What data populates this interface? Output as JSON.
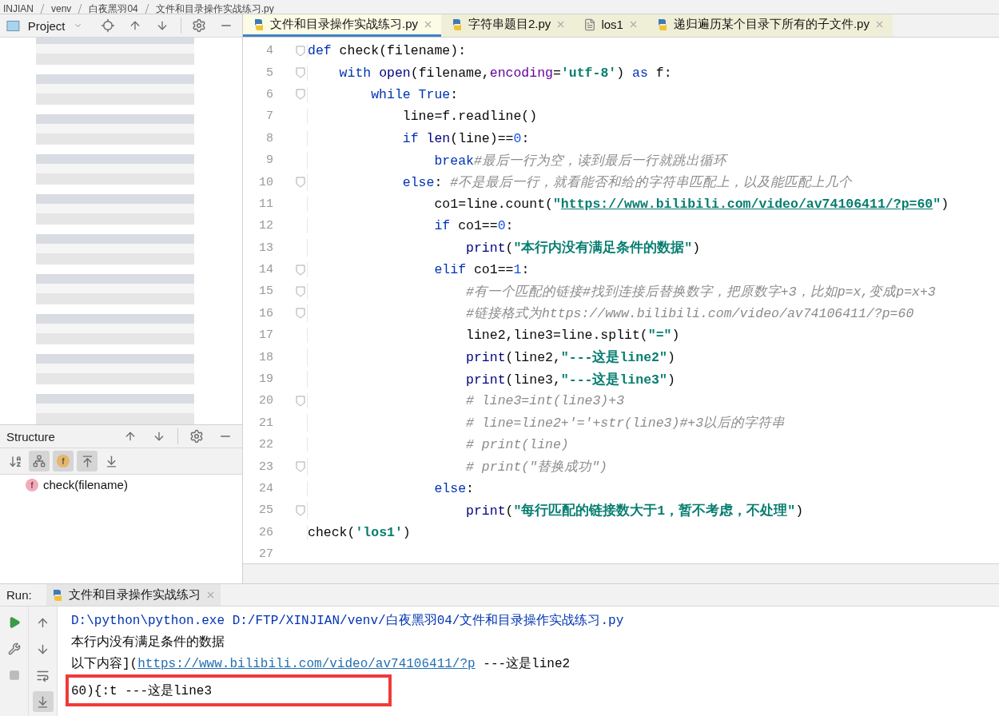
{
  "breadcrumb": [
    "INJIAN",
    "venv",
    "白夜黑羽04",
    "文件和目录操作实战练习.py"
  ],
  "project_panel": {
    "title": "Project"
  },
  "structure_panel": {
    "title": "Structure",
    "toolbar": [
      {
        "kind": "sort",
        "selected": false
      },
      {
        "kind": "inherited",
        "selected": true
      },
      {
        "kind": "fields",
        "label": "f",
        "selected": true
      },
      {
        "kind": "expand",
        "selected": true
      },
      {
        "kind": "collapse",
        "selected": false
      }
    ],
    "items": [
      {
        "icon": "f",
        "label": "check(filename)"
      }
    ]
  },
  "tabs": [
    {
      "label": "文件和目录操作实战练习.py",
      "kind": "python",
      "selected": true
    },
    {
      "label": "字符串题目2.py",
      "kind": "python",
      "selected": false
    },
    {
      "label": "los1",
      "kind": "text",
      "selected": false
    },
    {
      "label": "递归遍历某个目录下所有的子文件.py",
      "kind": "python",
      "selected": false
    }
  ],
  "code_lines": [
    {
      "number": "4",
      "fold": true,
      "tokens": [
        {
          "kind": "kw",
          "text": "def"
        },
        {
          "kind": "plain",
          "text": " check(filename):"
        }
      ]
    },
    {
      "number": "5",
      "fold": true,
      "tokens": [
        {
          "kind": "kw",
          "text": "    with "
        },
        {
          "kind": "builtin",
          "text": "open"
        },
        {
          "kind": "plain",
          "text": "(filename,"
        },
        {
          "kind": "param",
          "text": "encoding"
        },
        {
          "kind": "plain",
          "text": "="
        },
        {
          "kind": "str",
          "text": "'utf-8'"
        },
        {
          "kind": "plain",
          "text": ") "
        },
        {
          "kind": "kw",
          "text": "as"
        },
        {
          "kind": "plain",
          "text": " f:"
        }
      ]
    },
    {
      "number": "6",
      "fold": true,
      "tokens": [
        {
          "kind": "kw",
          "text": "        while True"
        },
        {
          "kind": "plain",
          "text": ":"
        }
      ]
    },
    {
      "number": "7",
      "fold": false,
      "tokens": [
        {
          "kind": "plain",
          "text": "            line=f.readline()"
        }
      ]
    },
    {
      "number": "8",
      "fold": false,
      "tokens": [
        {
          "kind": "kw",
          "text": "            if "
        },
        {
          "kind": "builtin",
          "text": "len"
        },
        {
          "kind": "plain",
          "text": "(line)=="
        },
        {
          "kind": "num",
          "text": "0"
        },
        {
          "kind": "plain",
          "text": ":"
        }
      ]
    },
    {
      "number": "9",
      "fold": false,
      "tokens": [
        {
          "kind": "kw",
          "text": "                break"
        },
        {
          "kind": "com",
          "text": "#最后一行为空，读到最后一行就跳出循环"
        }
      ]
    },
    {
      "number": "10",
      "fold": true,
      "tokens": [
        {
          "kind": "kw",
          "text": "            else"
        },
        {
          "kind": "plain",
          "text": ": "
        },
        {
          "kind": "com",
          "text": "#不是最后一行，就看能否和给的字符串匹配上，以及能匹配上几个"
        }
      ]
    },
    {
      "number": "11",
      "fold": false,
      "tokens": [
        {
          "kind": "plain",
          "text": "                co1=line.count("
        },
        {
          "kind": "str",
          "text": "\""
        },
        {
          "kind": "link",
          "text": "https://www.bilibili.com/video/av74106411/?p=60"
        },
        {
          "kind": "str",
          "text": "\""
        },
        {
          "kind": "plain",
          "text": ")"
        }
      ]
    },
    {
      "number": "12",
      "fold": false,
      "tokens": [
        {
          "kind": "kw",
          "text": "                if"
        },
        {
          "kind": "plain",
          "text": " co1=="
        },
        {
          "kind": "num",
          "text": "0"
        },
        {
          "kind": "plain",
          "text": ":"
        }
      ]
    },
    {
      "number": "13",
      "fold": false,
      "tokens": [
        {
          "kind": "builtin",
          "text": "                    print"
        },
        {
          "kind": "plain",
          "text": "("
        },
        {
          "kind": "str",
          "text": "\"本行内没有满足条件的数据\""
        },
        {
          "kind": "plain",
          "text": ")"
        }
      ]
    },
    {
      "number": "14",
      "fold": true,
      "tokens": [
        {
          "kind": "kw",
          "text": "                elif"
        },
        {
          "kind": "plain",
          "text": " co1=="
        },
        {
          "kind": "num",
          "text": "1"
        },
        {
          "kind": "plain",
          "text": ":"
        }
      ]
    },
    {
      "number": "15",
      "fold": true,
      "tokens": [
        {
          "kind": "com",
          "text": "                    #有一个匹配的链接#找到连接后替换数字，把原数字+3，比如p=x,变成p=x+3"
        }
      ]
    },
    {
      "number": "16",
      "fold": true,
      "tokens": [
        {
          "kind": "com",
          "text": "                    #链接格式为https://www.bilibili.com/video/av74106411/?p=60"
        }
      ]
    },
    {
      "number": "17",
      "fold": false,
      "tokens": [
        {
          "kind": "plain",
          "text": "                    line2,line3=line.split("
        },
        {
          "kind": "str",
          "text": "\"=\""
        },
        {
          "kind": "plain",
          "text": ")"
        }
      ]
    },
    {
      "number": "18",
      "fold": false,
      "tokens": [
        {
          "kind": "builtin",
          "text": "                    print"
        },
        {
          "kind": "plain",
          "text": "(line2,"
        },
        {
          "kind": "str",
          "text": "\"---这是line2\""
        },
        {
          "kind": "plain",
          "text": ")"
        }
      ]
    },
    {
      "number": "19",
      "fold": false,
      "tokens": [
        {
          "kind": "builtin",
          "text": "                    print"
        },
        {
          "kind": "plain",
          "text": "(line3,"
        },
        {
          "kind": "str",
          "text": "\"---这是line3\""
        },
        {
          "kind": "plain",
          "text": ")"
        }
      ]
    },
    {
      "number": "20",
      "fold": true,
      "tokens": [
        {
          "kind": "com",
          "text": "                    # line3=int(line3)+3"
        }
      ]
    },
    {
      "number": "21",
      "fold": false,
      "tokens": [
        {
          "kind": "com",
          "text": "                    # line=line2+'='+str(line3)#+3以后的字符串"
        }
      ]
    },
    {
      "number": "22",
      "fold": false,
      "tokens": [
        {
          "kind": "com",
          "text": "                    # print(line)"
        }
      ]
    },
    {
      "number": "23",
      "fold": true,
      "tokens": [
        {
          "kind": "com",
          "text": "                    # print(\"替换成功\")"
        }
      ]
    },
    {
      "number": "24",
      "fold": false,
      "tokens": [
        {
          "kind": "kw",
          "text": "                else"
        },
        {
          "kind": "plain",
          "text": ":"
        }
      ]
    },
    {
      "number": "25",
      "fold": true,
      "tokens": [
        {
          "kind": "builtin",
          "text": "                    print"
        },
        {
          "kind": "plain",
          "text": "("
        },
        {
          "kind": "str",
          "text": "\"每行匹配的链接数大于1，暂不考虑，不处理\""
        },
        {
          "kind": "plain",
          "text": ")"
        }
      ]
    },
    {
      "number": "26",
      "fold": false,
      "tokens": [
        {
          "kind": "plain",
          "text": "check("
        },
        {
          "kind": "str",
          "text": "'los1'"
        },
        {
          "kind": "plain",
          "text": ")"
        }
      ]
    },
    {
      "number": "27",
      "fold": false
    }
  ],
  "run_panel": {
    "title": "Run:",
    "tab": "文件和目录操作实战练习",
    "output": [
      {
        "highlighted": false,
        "segments": [
          {
            "kind": "command",
            "text": "D:\\python\\python.exe D:/FTP/XINJIAN/venv/白夜黑羽04/文件和目录操作实战练习.py"
          }
        ]
      },
      {
        "highlighted": false,
        "segments": [
          {
            "kind": "plain",
            "text": "本行内没有满足条件的数据"
          }
        ]
      },
      {
        "highlighted": false,
        "segments": [
          {
            "kind": "plain",
            "text": "以下内容]("
          },
          {
            "kind": "link",
            "text": "https://www.bilibili.com/video/av74106411/?p"
          },
          {
            "kind": "plain",
            "text": " ---这是line2"
          }
        ]
      },
      {
        "highlighted": true,
        "segments": [
          {
            "kind": "plain",
            "text": "60){:t ---这是line3"
          }
        ]
      }
    ]
  }
}
